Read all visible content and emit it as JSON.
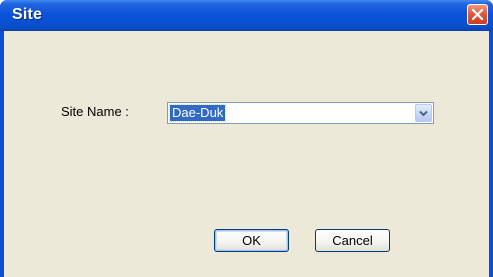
{
  "window": {
    "title": "Site",
    "close_icon": "close-icon"
  },
  "form": {
    "site_name_label": "Site Name :",
    "site_name_value": "Dae-Duk",
    "dropdown_icon": "chevron-down-icon"
  },
  "buttons": {
    "ok_label": "OK",
    "cancel_label": "Cancel"
  },
  "colors": {
    "titlebar": "#0a53d8",
    "dialog_bg": "#ece9d8",
    "selection": "#316ac5",
    "close_button": "#e2593a"
  }
}
